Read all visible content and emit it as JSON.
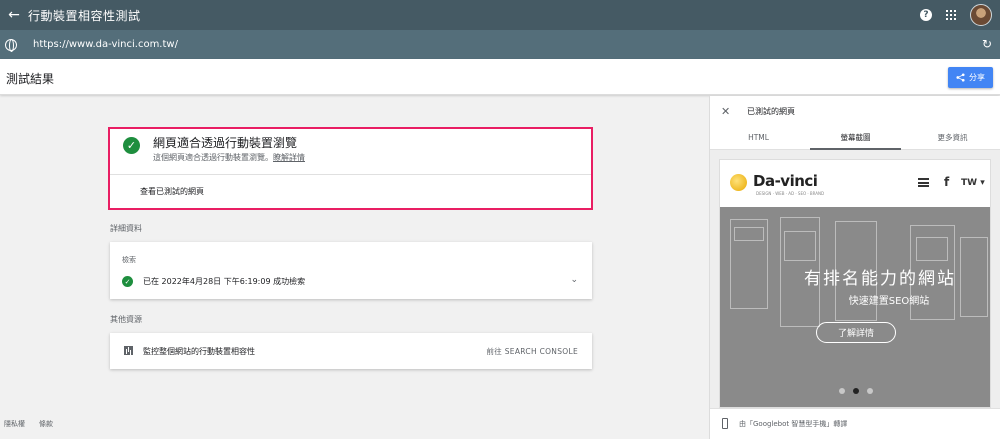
{
  "appbar": {
    "back_icon": "arrow-back-icon",
    "title": "行動裝置相容性測試"
  },
  "urlbar": {
    "url": "https://www.da-vinci.com.tw/"
  },
  "header": {
    "title": "測試結果",
    "share_label": "分享"
  },
  "result": {
    "heading": "網頁適合透過行動裝置瀏覽",
    "description": "這個網頁適合透過行動裝置瀏覽。",
    "learn_more": "瞭解詳情",
    "view_tested": "查看已測試的網頁"
  },
  "details": {
    "section_label": "詳細資料",
    "crawl_label": "檢索",
    "crawl_status": "已在 2022年4月28日 下午6:19:09 成功檢索"
  },
  "resources": {
    "section_label": "其他資源",
    "monitor_text": "監控整個網站的行動裝置相容性",
    "console_link": "前往 SEARCH CONSOLE"
  },
  "footer": {
    "privacy": "隱私權",
    "terms": "條款"
  },
  "panel": {
    "title": "已測試的網頁",
    "tabs": [
      "HTML",
      "螢幕截圖",
      "更多資訊"
    ],
    "active_tab": 1,
    "render_note": "由「Googlebot 智慧型手機」轉譯",
    "screenshot": {
      "logo": "Da-vinci",
      "logo_tagline": "DESIGN · WEB · AD · SEO · BRAND",
      "fb": "f",
      "lang": "TW ▾",
      "hero_title": "有排名能力的網站",
      "hero_sub": "快速建置SEO網站",
      "hero_button": "了解詳情",
      "carousel_dots": 3,
      "carousel_active": 2
    }
  },
  "colors": {
    "appbar": "#455a64",
    "urlbar": "#546e7a",
    "accent": "#4285f4",
    "highlight": "#e91e63",
    "success": "#1e8e3e"
  }
}
